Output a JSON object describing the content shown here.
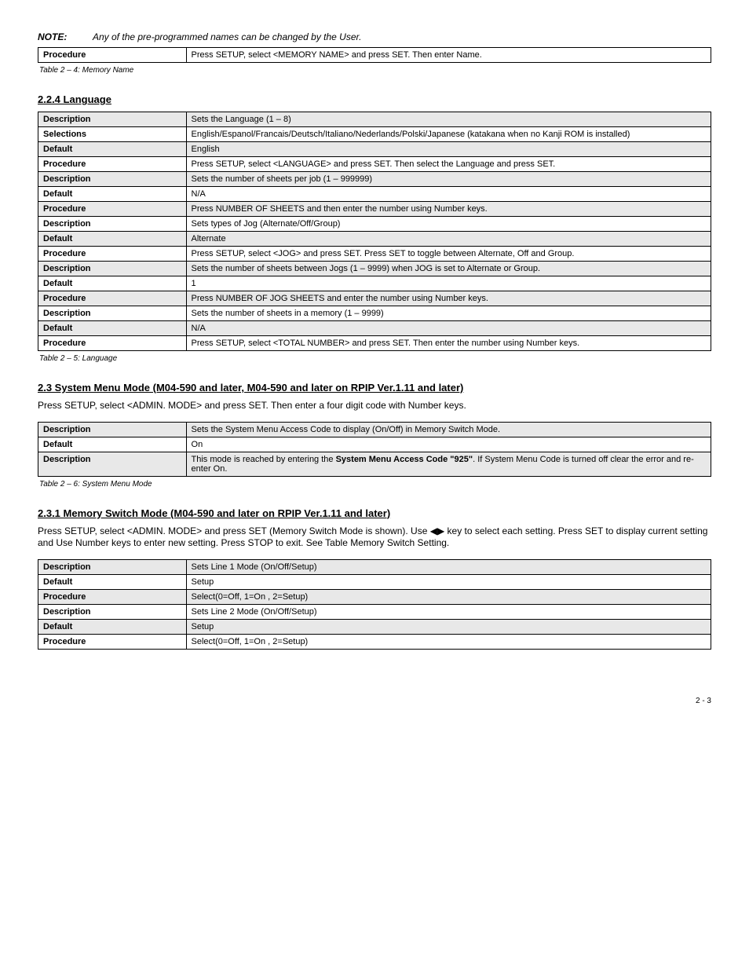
{
  "note1": {
    "label": "NOTE:",
    "text": "Any of the pre-programmed names can be changed by the User."
  },
  "table1": {
    "r1c1": "Procedure",
    "r1c2": "Press SETUP, select <MEMORY NAME> and press SET. Then enter Name."
  },
  "caption1": "Table 2 – 4: Memory Name",
  "section2": {
    "heading": "2.2.4 Language",
    "r1": {
      "c1": "Description",
      "c2": "Sets the Language (1 – 8)"
    },
    "r2": {
      "c1": "Selections",
      "c2": "English/Espanol/Francais/Deutsch/Italiano/Nederlands/Polski/Japanese (katakana when no Kanji ROM is installed)"
    },
    "r3": {
      "c1": "Default",
      "c2": "English"
    },
    "r4": {
      "c1": "Procedure",
      "c2": "Press SETUP, select <LANGUAGE> and press SET. Then select the Language and press SET."
    },
    "r5": {
      "c1": "Description",
      "c2": "Sets the number of sheets per job (1 – 999999)"
    },
    "r6": {
      "c1": "Default",
      "c2": "N/A"
    },
    "r7": {
      "c1": "Procedure",
      "c2": "Press NUMBER OF SHEETS and then enter the number using Number keys."
    },
    "r8": {
      "c1": "Description",
      "c2": "Sets types of Jog (Alternate/Off/Group)"
    },
    "r9": {
      "c1": "Default",
      "c2": "Alternate"
    },
    "r10": {
      "c1": "Procedure",
      "c2": "Press SETUP, select <JOG> and press SET. Press SET to toggle between Alternate, Off and Group."
    },
    "r11": {
      "c1": "Description",
      "c2": "Sets the number of sheets between Jogs (1 – 9999) when JOG is set to Alternate or Group."
    },
    "r12": {
      "c1": "Default",
      "c2": "1"
    },
    "r13": {
      "c1": "Procedure",
      "c2": "Press NUMBER OF JOG SHEETS and enter the number using Number keys."
    },
    "r14": {
      "c1": "Description",
      "c2": "Sets the number of sheets in a memory (1 – 9999)"
    },
    "r15": {
      "c1": "Default",
      "c2": "N/A"
    },
    "r16": {
      "c1": "Procedure",
      "c2": "Press SETUP, select <TOTAL NUMBER> and press SET. Then enter the number using Number keys.",
      "caption": "Table 2 – 5: Language"
    }
  },
  "section3": {
    "heading": "2.3 System Menu Mode (M04-590 and later, M04-590 and later on RPIP Ver.1.11 and later)",
    "para": "Press SETUP, select <ADMIN. MODE> and press SET. Then enter a four digit code with Number keys.",
    "r1": {
      "c1": "Description",
      "c2": "Sets the System Menu Access Code to display (On/Off) in Memory Switch Mode."
    },
    "r2": {
      "c1": "Default",
      "c2": "On"
    },
    "r3": {
      "c1": "Description",
      "c2": "This mode is reached by entering the System Menu Access Code \"925\". If System Menu Code is turned off clear the error and re-enter On."
    },
    "caption": "Table 2 – 6: System Menu Mode"
  },
  "section4": {
    "heading": "2.3.1 Memory Switch Mode (M04-590 and later on RPIP Ver.1.11 and later)",
    "para": "Press SETUP, select <ADMIN. MODE> and press SET (Memory Switch Mode is shown). Use ◀▶ key to select each setting. Press SET to display current setting and Use Number keys to enter new setting. Press STOP to exit. See Table Memory Switch Setting.",
    "r1": {
      "c1": "Description",
      "c2": "Sets Line 1 Mode (On/Off/Setup)"
    },
    "r2": {
      "c1": "Default",
      "c2": "Setup"
    },
    "r3": {
      "c1": "Procedure",
      "c2": "Select(0=Off, 1=On , 2=Setup)"
    },
    "r4": {
      "c1": "Description",
      "c2": "Sets Line 2 Mode (On/Off/Setup)"
    },
    "r5": {
      "c1": "Default",
      "c2": "Setup"
    },
    "r6": {
      "c1": "Procedure",
      "c2": "Select(0=Off, 1=On , 2=Setup)"
    }
  },
  "pagenum": "2 - 3"
}
